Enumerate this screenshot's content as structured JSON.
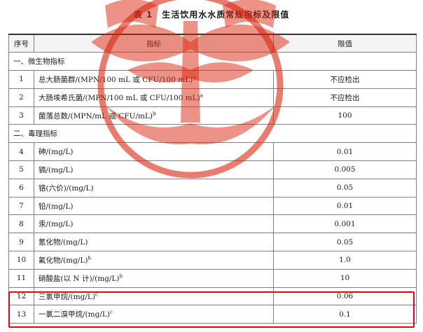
{
  "title": "表 1　生活饮用水水质常规指标及限值",
  "headers": {
    "no": "序号",
    "indicator": "指标",
    "limit": "限值"
  },
  "sections": [
    {
      "label": "一、微生物指标",
      "rows": [
        {
          "no": "1",
          "name": "总大肠菌群/(MPN/100 mL 或 CFU/100 mL)",
          "note": "a",
          "limit": "不应检出"
        },
        {
          "no": "2",
          "name": "大肠埃希氏菌/(MPN/100 mL 或 CFU/100 mL)",
          "note": "a",
          "limit": "不应检出"
        },
        {
          "no": "3",
          "name": "菌落总数/(MPN/mL 或 CFU/mL)",
          "note": "b",
          "limit": "100"
        }
      ]
    },
    {
      "label": "二、毒理指标",
      "rows": [
        {
          "no": "4",
          "name": "砷/(mg/L)",
          "note": "",
          "limit": "0.01"
        },
        {
          "no": "5",
          "name": "镉/(mg/L)",
          "note": "",
          "limit": "0.005"
        },
        {
          "no": "6",
          "name": "铬(六价)/(mg/L)",
          "note": "",
          "limit": "0.05"
        },
        {
          "no": "7",
          "name": "铅/(mg/L)",
          "note": "",
          "limit": "0.01"
        },
        {
          "no": "8",
          "name": "汞/(mg/L)",
          "note": "",
          "limit": "0.001"
        },
        {
          "no": "9",
          "name": "氰化物/(mg/L)",
          "note": "",
          "limit": "0.05"
        },
        {
          "no": "10",
          "name": "氟化物/(mg/L)",
          "note": "b",
          "limit": "1.0"
        },
        {
          "no": "11",
          "name": "硝酸盐(以 N 计)/(mg/L)",
          "note": "b",
          "limit": "10"
        },
        {
          "no": "12",
          "name": "三氯甲烷/(mg/L)",
          "note": "c",
          "limit": "0.06"
        },
        {
          "no": "13",
          "name": "一氯二溴甲烷/(mg/L)",
          "note": "c",
          "limit": "0.1"
        }
      ]
    }
  ],
  "colors": {
    "highlight": "#e60012",
    "watermark": "#d9250f"
  }
}
